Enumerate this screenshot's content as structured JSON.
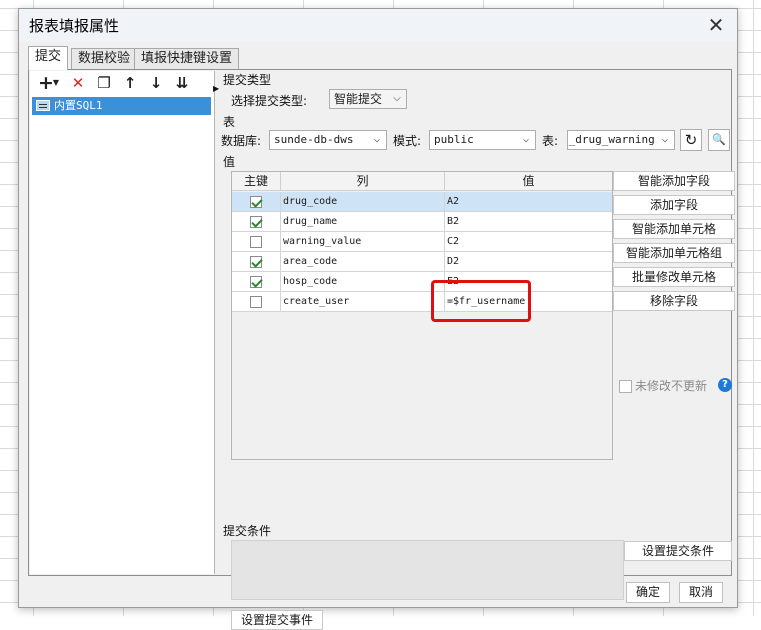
{
  "window": {
    "title": "报表填报属性",
    "close_glyph": "✕"
  },
  "tabs": [
    {
      "label": "提交"
    },
    {
      "label": "数据校验"
    },
    {
      "label": "填报快捷键设置"
    }
  ],
  "left_toolbar": {
    "icons": [
      "plus-icon",
      "delete-icon",
      "copy-icon",
      "arrow-up-icon",
      "arrow-down-icon",
      "move-bottom-icon"
    ],
    "add_glyph": "+",
    "delete_glyph": "✕",
    "copy_glyph": "❐",
    "up_glyph": "↑",
    "down_glyph": "↓",
    "bottom_glyph": "⇊"
  },
  "tree": {
    "item_label": "内置SQL1"
  },
  "submit_type": {
    "section_label": "提交类型",
    "field_label": "选择提交类型:",
    "value": "智能提交"
  },
  "table_section": {
    "section_label": "表",
    "db_label": "数据库:",
    "db_value": "sunde-db-dws",
    "schema_label": "模式:",
    "schema_value": "public",
    "table_label": "表:",
    "table_value": "t_drug_warning",
    "refresh_glyph": "↻",
    "preview_glyph": "🔍"
  },
  "value_section": {
    "section_label": "值",
    "columns": [
      "主键",
      "列",
      "值"
    ],
    "rows": [
      {
        "key": true,
        "column": "drug_code",
        "value": "A2"
      },
      {
        "key": true,
        "column": "drug_name",
        "value": "B2"
      },
      {
        "key": false,
        "column": "warning_value",
        "value": "C2"
      },
      {
        "key": true,
        "column": "area_code",
        "value": "D2"
      },
      {
        "key": true,
        "column": "hosp_code",
        "value": "E2"
      },
      {
        "key": false,
        "column": "create_user",
        "value": "=$fr_username"
      }
    ],
    "highlight_color": "#e01010"
  },
  "side_buttons": {
    "smart_add_field": "智能添加字段",
    "add_field": "添加字段",
    "smart_add_cell": "智能添加单元格",
    "smart_add_cell_group": "智能添加单元格组",
    "batch_modify_cell": "批量修改单元格",
    "remove_field": "移除字段",
    "no_update_label": "未修改不更新",
    "help_glyph": "?"
  },
  "submit_condition": {
    "section_label": "提交条件",
    "button_label": "设置提交条件"
  },
  "submit_event": {
    "button_label": "设置提交事件"
  },
  "footer": {
    "ok_label": "确定",
    "cancel_label": "取消"
  },
  "colors": {
    "selection": "#3b90d8",
    "accent_help": "#1f7ad8",
    "check": "#2a8a2a"
  }
}
